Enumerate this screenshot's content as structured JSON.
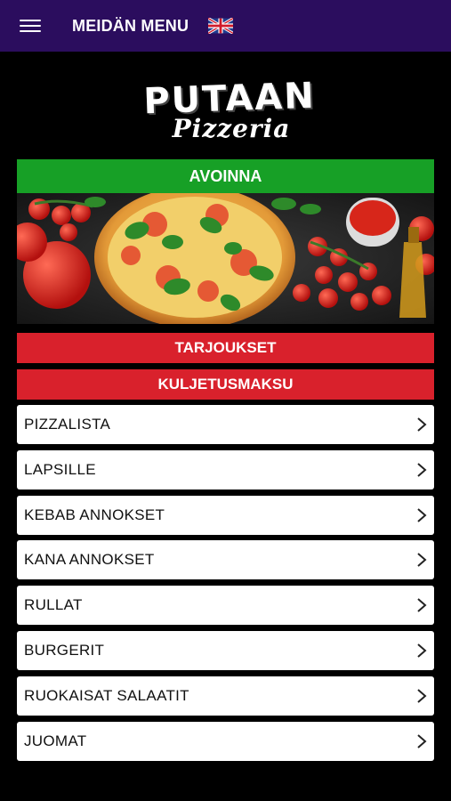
{
  "topbar": {
    "title": "MEIDÄN MENU",
    "menu_icon": "hamburger-icon",
    "flag_icon": "uk-flag-icon"
  },
  "logo": {
    "main": "PUTAAN",
    "sub": "Pizzeria"
  },
  "status": {
    "label": "AVOINNA",
    "color": "#17a026"
  },
  "promos": {
    "offers_label": "TARJOUKSET",
    "delivery_label": "KULJETUSMAKSU",
    "color": "#d9212c"
  },
  "menu": {
    "items": [
      {
        "label": "PIZZALISTA"
      },
      {
        "label": "LAPSILLE"
      },
      {
        "label": "KEBAB ANNOKSET"
      },
      {
        "label": "KANA ANNOKSET"
      },
      {
        "label": "RULLAT"
      },
      {
        "label": "BURGERIT"
      },
      {
        "label": "RUOKAISAT SALAATIT"
      },
      {
        "label": "JUOMAT"
      }
    ],
    "chevron_icon": "chevron-right-icon"
  },
  "colors": {
    "header_bg": "#2b0d5e",
    "page_bg": "#000000"
  }
}
